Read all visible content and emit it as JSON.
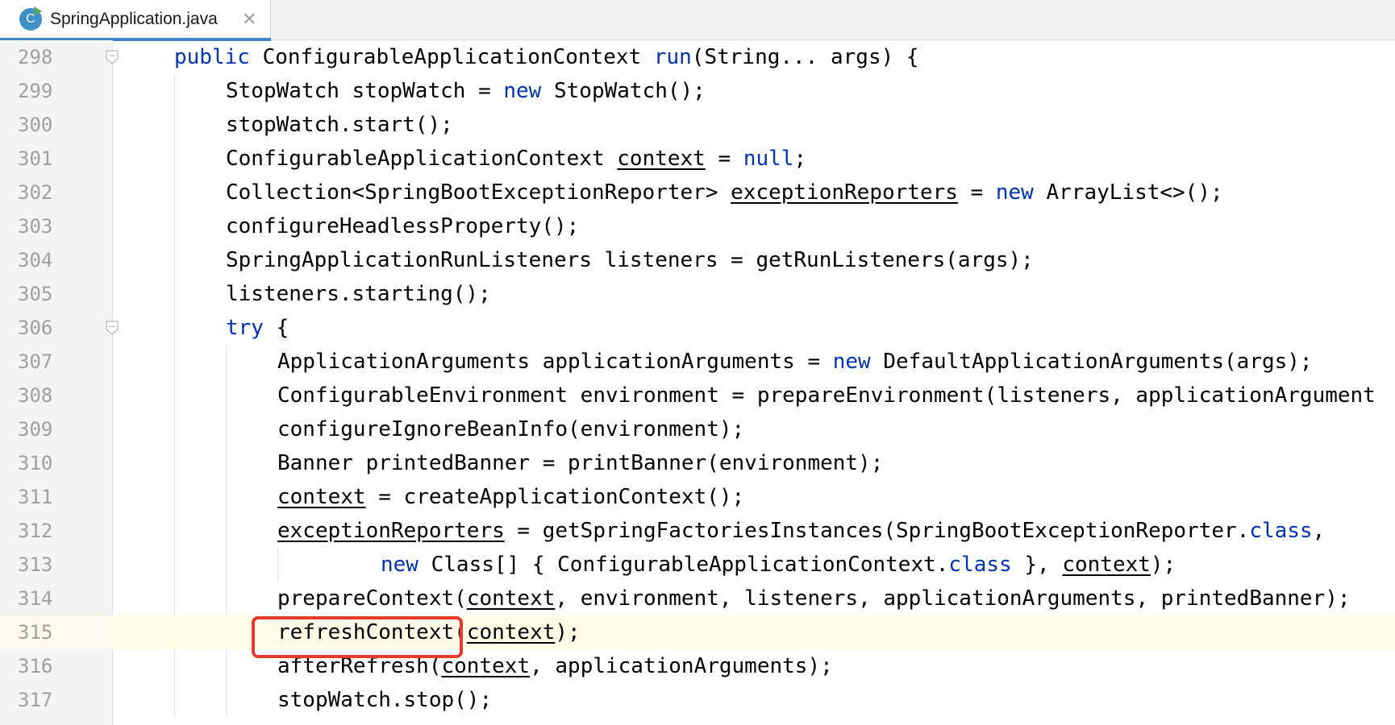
{
  "tab": {
    "icon_letter": "C",
    "title": "SpringApplication.java",
    "close_glyph": "✕"
  },
  "editor": {
    "current_line": "315",
    "lines": [
      {
        "num": "298",
        "indent": 0,
        "fold": true,
        "segments": [
          {
            "t": "public",
            "k": "kw"
          },
          {
            "t": " ConfigurableApplicationContext "
          },
          {
            "t": "run",
            "k": "kw"
          },
          {
            "t": "(String... args) {"
          }
        ]
      },
      {
        "num": "299",
        "indent": 1,
        "segments": [
          {
            "t": "StopWatch stopWatch = "
          },
          {
            "t": "new",
            "k": "kw"
          },
          {
            "t": " StopWatch();"
          }
        ]
      },
      {
        "num": "300",
        "indent": 1,
        "segments": [
          {
            "t": "stopWatch.start();"
          }
        ]
      },
      {
        "num": "301",
        "indent": 1,
        "segments": [
          {
            "t": "ConfigurableApplicationContext "
          },
          {
            "t": "context",
            "k": "ul"
          },
          {
            "t": " = "
          },
          {
            "t": "null",
            "k": "kw"
          },
          {
            "t": ";"
          }
        ]
      },
      {
        "num": "302",
        "indent": 1,
        "segments": [
          {
            "t": "Collection<SpringBootExceptionReporter> "
          },
          {
            "t": "exceptionReporters",
            "k": "ul"
          },
          {
            "t": " = "
          },
          {
            "t": "new",
            "k": "kw"
          },
          {
            "t": " ArrayList<>();"
          }
        ]
      },
      {
        "num": "303",
        "indent": 1,
        "segments": [
          {
            "t": "configureHeadlessProperty();"
          }
        ]
      },
      {
        "num": "304",
        "indent": 1,
        "segments": [
          {
            "t": "SpringApplicationRunListeners listeners = getRunListeners(args);"
          }
        ]
      },
      {
        "num": "305",
        "indent": 1,
        "segments": [
          {
            "t": "listeners.starting();"
          }
        ]
      },
      {
        "num": "306",
        "indent": 1,
        "fold": true,
        "segments": [
          {
            "t": "try",
            "k": "kw"
          },
          {
            "t": " {"
          }
        ]
      },
      {
        "num": "307",
        "indent": 2,
        "segments": [
          {
            "t": "ApplicationArguments applicationArguments = "
          },
          {
            "t": "new",
            "k": "kw"
          },
          {
            "t": " DefaultApplicationArguments(args);"
          }
        ]
      },
      {
        "num": "308",
        "indent": 2,
        "segments": [
          {
            "t": "ConfigurableEnvironment environment = prepareEnvironment(listeners, applicationArgument"
          }
        ]
      },
      {
        "num": "309",
        "indent": 2,
        "segments": [
          {
            "t": "configureIgnoreBeanInfo(environment);"
          }
        ]
      },
      {
        "num": "310",
        "indent": 2,
        "segments": [
          {
            "t": "Banner printedBanner = printBanner(environment);"
          }
        ]
      },
      {
        "num": "311",
        "indent": 2,
        "segments": [
          {
            "t": "context",
            "k": "ul"
          },
          {
            "t": " = createApplicationContext();"
          }
        ]
      },
      {
        "num": "312",
        "indent": 2,
        "segments": [
          {
            "t": "exceptionReporters",
            "k": "ul"
          },
          {
            "t": " = getSpringFactoriesInstances(SpringBootExceptionReporter."
          },
          {
            "t": "class",
            "k": "kw"
          },
          {
            "t": ","
          }
        ]
      },
      {
        "num": "313",
        "indent": 4,
        "segments": [
          {
            "t": "new",
            "k": "kw"
          },
          {
            "t": " Class[] { ConfigurableApplicationContext."
          },
          {
            "t": "class",
            "k": "kw"
          },
          {
            "t": " }, "
          },
          {
            "t": "context",
            "k": "ul"
          },
          {
            "t": ");"
          }
        ]
      },
      {
        "num": "314",
        "indent": 2,
        "segments": [
          {
            "t": "prepareContext("
          },
          {
            "t": "context",
            "k": "ul"
          },
          {
            "t": ", environment, listeners, applicationArguments, printedBanner);"
          }
        ]
      },
      {
        "num": "315",
        "indent": 2,
        "segments": [
          {
            "t": "refreshContext("
          },
          {
            "t": "context",
            "k": "ul"
          },
          {
            "t": ");"
          }
        ]
      },
      {
        "num": "316",
        "indent": 2,
        "segments": [
          {
            "t": "afterRefresh("
          },
          {
            "t": "context",
            "k": "ul"
          },
          {
            "t": ", applicationArguments);"
          }
        ]
      },
      {
        "num": "317",
        "indent": 2,
        "segments": [
          {
            "t": "stopWatch.stop();"
          }
        ]
      }
    ]
  },
  "colors": {
    "keyword": "#0033b3",
    "highlight_box": "#e33b2e",
    "tab_accent": "#4083c9",
    "current_line_bg": "#fefbe6"
  }
}
